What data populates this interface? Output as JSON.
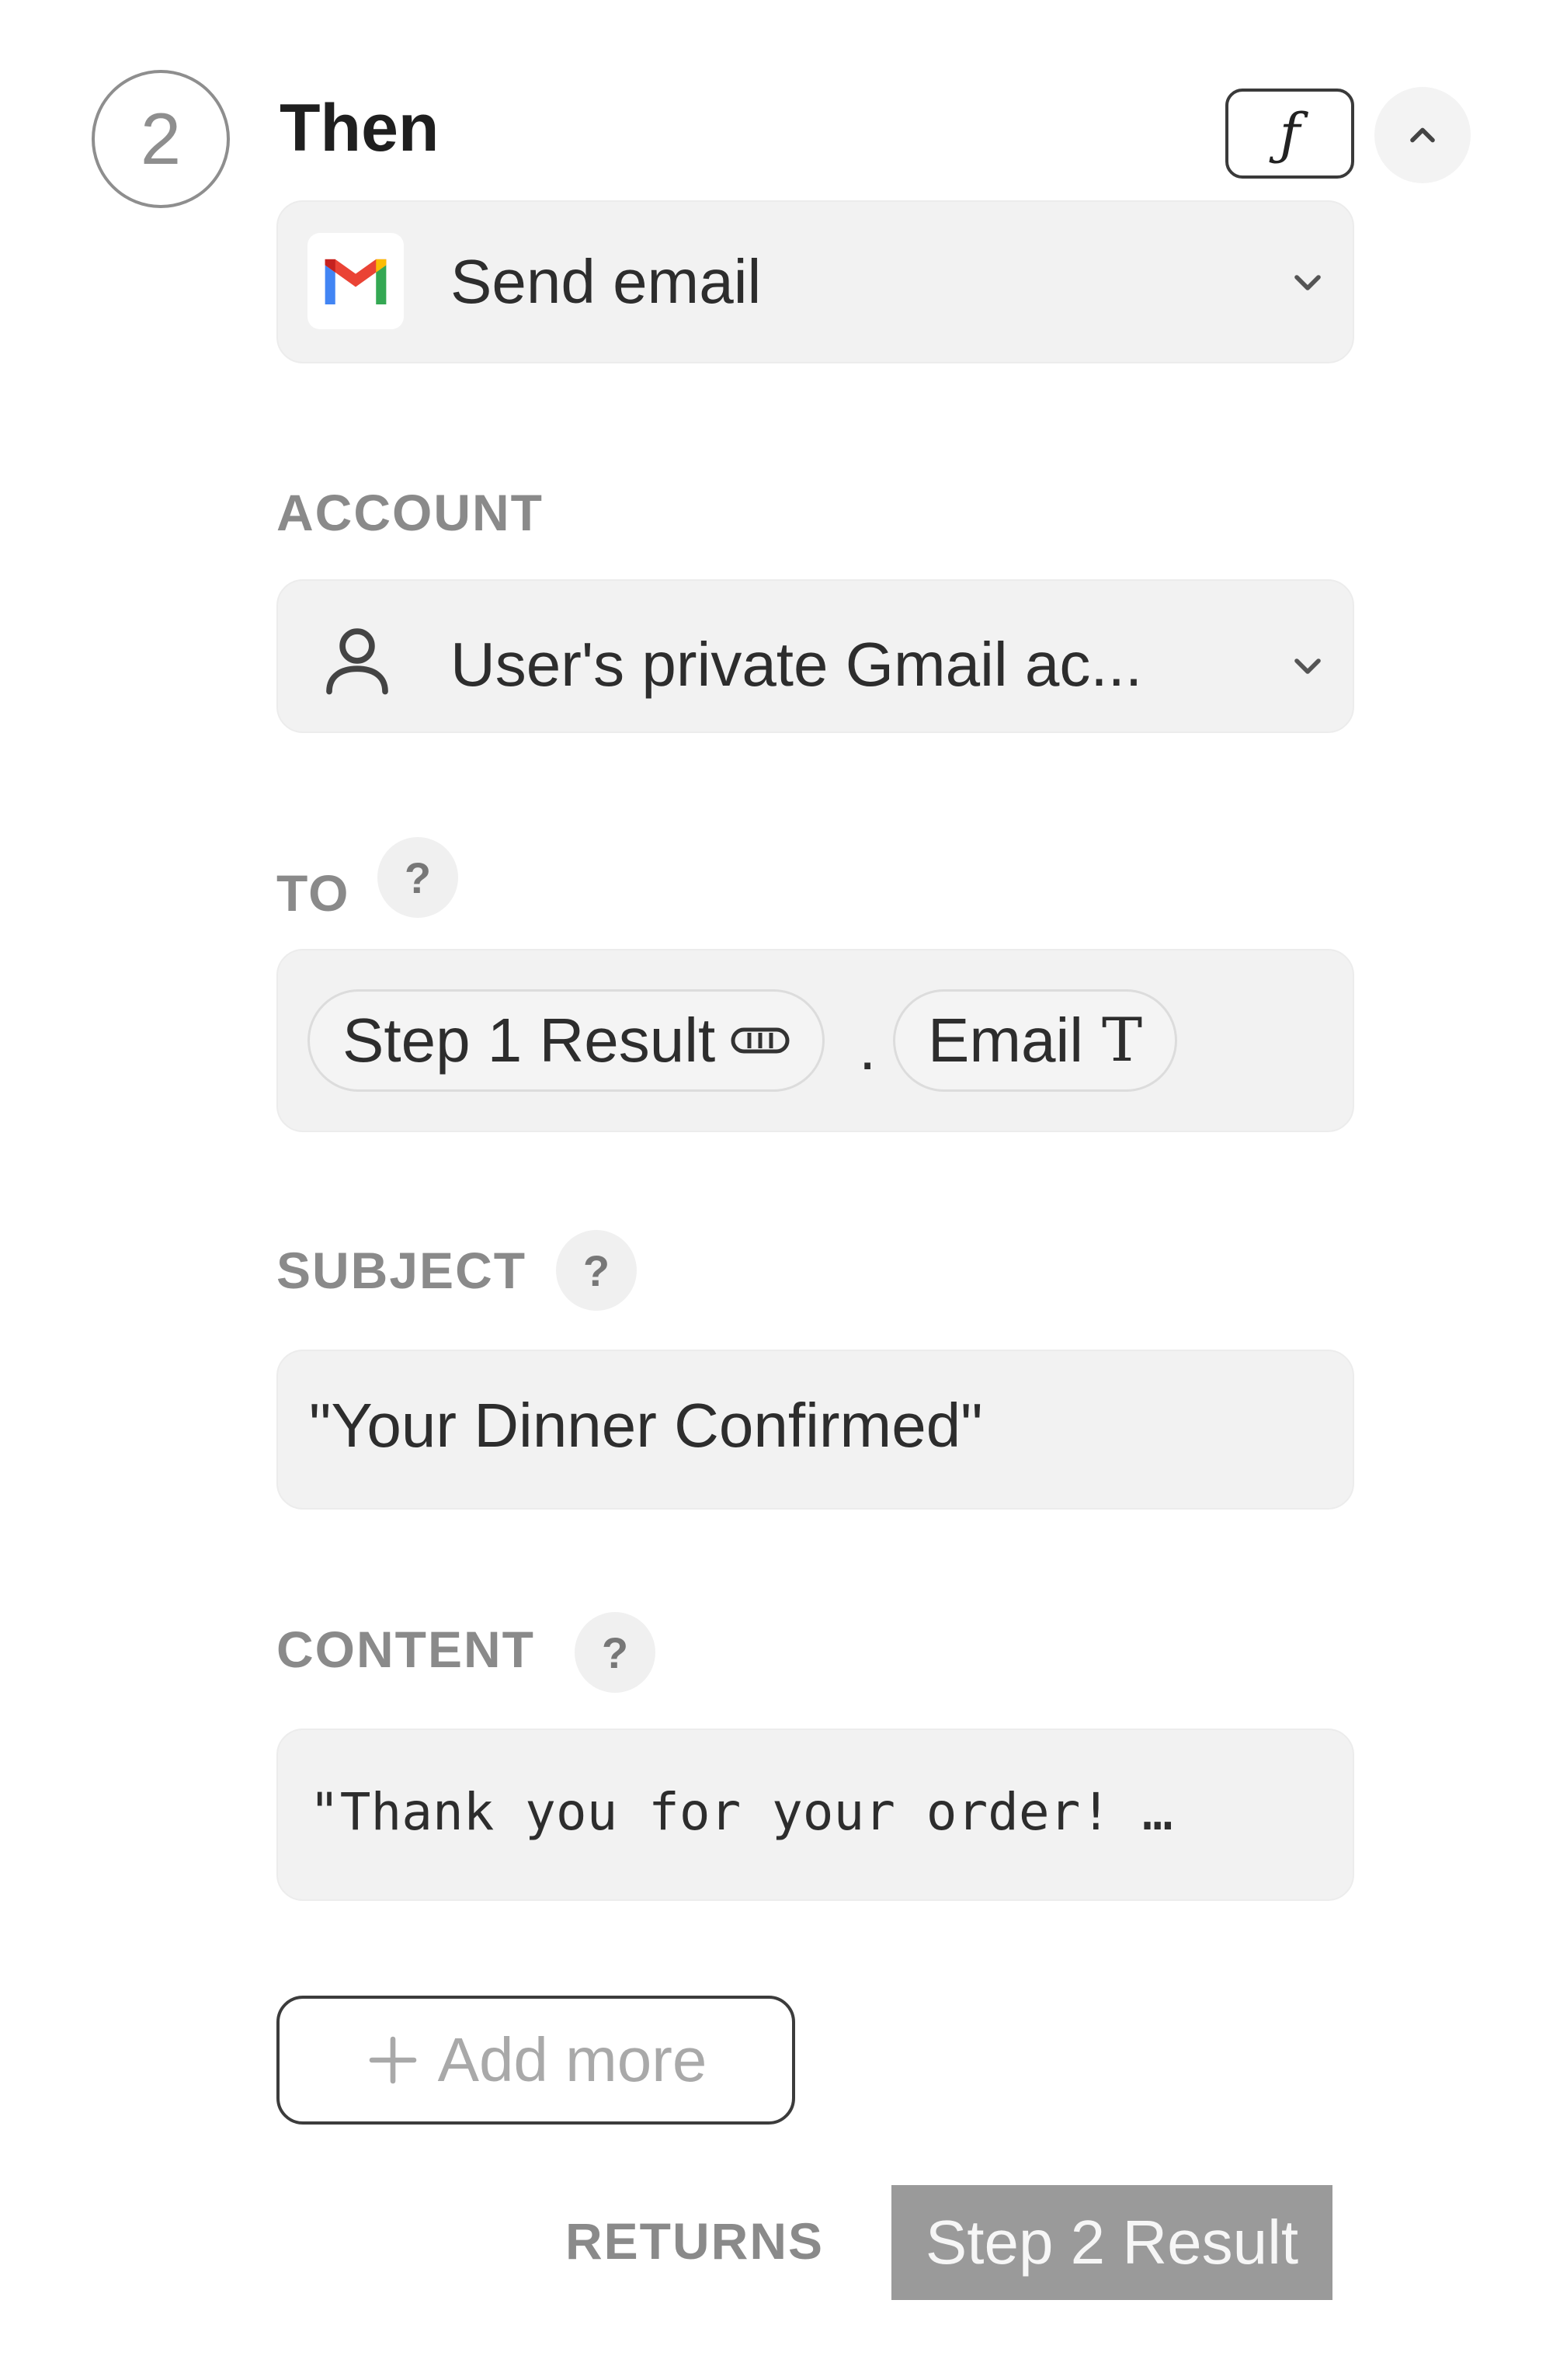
{
  "step": {
    "number": "2",
    "title": "Then"
  },
  "toolbar": {
    "formula_label": "ƒ"
  },
  "action": {
    "label": "Send email",
    "icon": "gmail-icon"
  },
  "account": {
    "label": "ACCOUNT",
    "value": "User's private Gmail ac...",
    "icon": "user-icon"
  },
  "to": {
    "label": "TO",
    "help": "?",
    "chips": [
      {
        "text": "Step 1 Result",
        "icon": "object-icon"
      },
      {
        "text": "Email",
        "icon": "text-type-icon"
      }
    ],
    "separator": "."
  },
  "subject": {
    "label": "SUBJECT",
    "help": "?",
    "value": "\"Your Dinner Confirmed\""
  },
  "content": {
    "label": "CONTENT",
    "help": "?",
    "value": "\"Thank you for your order! …"
  },
  "add_more": {
    "label": "Add more"
  },
  "returns": {
    "label": "RETURNS",
    "value": "Step 2 Result"
  },
  "colors": {
    "field_bg": "#f2f2f2",
    "label_gray": "#8a8a8a",
    "badge_bg": "#9a9a9a",
    "gmail_red": "#EA4335",
    "gmail_blue": "#4285F4",
    "gmail_green": "#34A853",
    "gmail_yellow": "#FBBC05"
  }
}
